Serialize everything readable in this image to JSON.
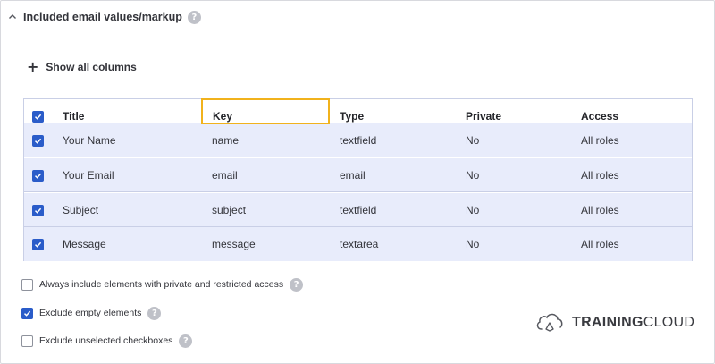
{
  "section": {
    "title": "Included email values/markup",
    "help": "?"
  },
  "show_columns": {
    "label": "Show all columns"
  },
  "table": {
    "columns": [
      "Title",
      "Key",
      "Type",
      "Private",
      "Access"
    ],
    "rows": [
      {
        "title": "Your Name",
        "key": "name",
        "type": "textfield",
        "private": "No",
        "access": "All roles",
        "checked": true
      },
      {
        "title": "Your Email",
        "key": "email",
        "type": "email",
        "private": "No",
        "access": "All roles",
        "checked": true
      },
      {
        "title": "Subject",
        "key": "subject",
        "type": "textfield",
        "private": "No",
        "access": "All roles",
        "checked": true
      },
      {
        "title": "Message",
        "key": "message",
        "type": "textarea",
        "private": "No",
        "access": "All roles",
        "checked": true
      }
    ]
  },
  "options": [
    {
      "label": "Always include elements with private and restricted access",
      "checked": false,
      "help": "?"
    },
    {
      "label": "Exclude empty elements",
      "checked": true,
      "help": "?"
    },
    {
      "label": "Exclude unselected checkboxes",
      "checked": false,
      "help": "?"
    }
  ],
  "brand": {
    "bold": "TRAINING",
    "light": "CLOUD"
  },
  "colors": {
    "accent": "#2a5cc9",
    "row_bg": "#e8ecfb",
    "highlight": "#f1b21c"
  }
}
